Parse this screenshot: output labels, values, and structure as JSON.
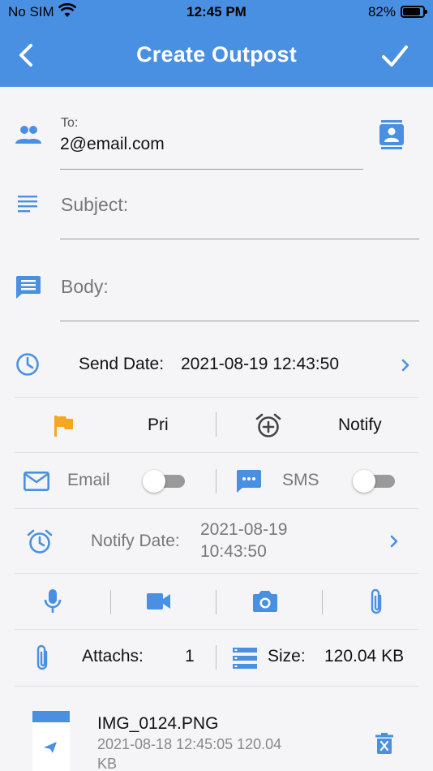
{
  "status_bar": {
    "carrier": "No SIM",
    "time": "12:45 PM",
    "battery": "82%"
  },
  "nav": {
    "title": "Create Outpost"
  },
  "compose": {
    "to_label": "To:",
    "to_value": "2@email.com",
    "subject_placeholder": "Subject:",
    "body_placeholder": "Body:"
  },
  "send_date": {
    "label": "Send Date:",
    "value": "2021-08-19 12:43:50"
  },
  "options": {
    "priority_label": "Pri",
    "notify_label": "Notify"
  },
  "channels": {
    "email_label": "Email",
    "email_on": false,
    "sms_label": "SMS",
    "sms_on": false
  },
  "notify_date": {
    "label": "Notify Date:",
    "value_line1": "2021-08-19",
    "value_line2": "10:43:50"
  },
  "attachments_summary": {
    "attachs_label": "Attachs:",
    "attachs_count": "1",
    "size_label": "Size:",
    "size_value": "120.04 KB"
  },
  "attachments": [
    {
      "name": "IMG_0124.PNG",
      "date_size": "2021-08-18 12:45:05  120.04",
      "size_unit": "KB"
    }
  ],
  "colors": {
    "accent": "#4a90e2",
    "flag": "#f5a623",
    "toggle_track": "#9a9a9a"
  },
  "icons": [
    "people-icon",
    "contact-card-icon",
    "subject-lines-icon",
    "chat-bubble-icon",
    "clock-icon",
    "chevron-right-icon",
    "flag-icon",
    "alarm-add-icon",
    "mail-icon",
    "sms-icon",
    "alarm-icon",
    "mic-icon",
    "video-icon",
    "camera-icon",
    "paperclip-icon",
    "storage-icon",
    "delete-icon"
  ]
}
